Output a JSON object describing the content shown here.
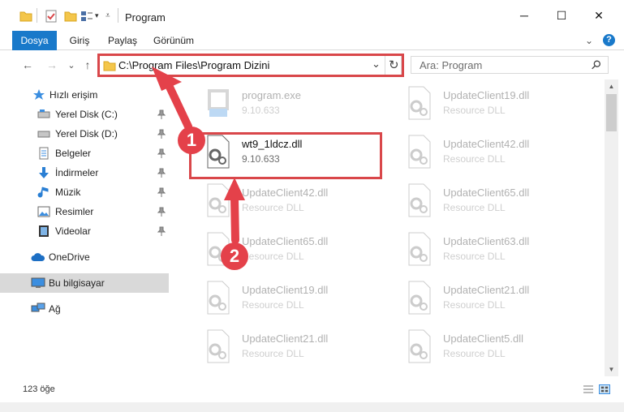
{
  "window": {
    "title": "Program",
    "minimize": "─",
    "maximize": "☐",
    "close": "✕"
  },
  "ribbon": {
    "tabs": [
      "Dosya",
      "Giriş",
      "Paylaş",
      "Görünüm"
    ],
    "expand": "⌄",
    "help": "?"
  },
  "nav": {
    "back": "←",
    "forward": "→",
    "recent": "⌄",
    "up": "↑",
    "address": "C:\\Program Files\\Program Dizini",
    "address_dropdown": "⌄",
    "refresh": "↻",
    "search_placeholder": "Ara: Program",
    "search_icon": "⚲"
  },
  "sidebar": {
    "items": [
      {
        "label": "Hızlı erişim",
        "icon": "star-icon",
        "pinned": false
      },
      {
        "label": "Yerel Disk (C:)",
        "icon": "drive-icon",
        "pinned": true
      },
      {
        "label": "Yerel Disk (D:)",
        "icon": "drive-icon",
        "pinned": true
      },
      {
        "label": "Belgeler",
        "icon": "document-icon",
        "pinned": true
      },
      {
        "label": "İndirmeler",
        "icon": "download-icon",
        "pinned": true
      },
      {
        "label": "Müzik",
        "icon": "music-icon",
        "pinned": true
      },
      {
        "label": "Resimler",
        "icon": "picture-icon",
        "pinned": true
      },
      {
        "label": "Videolar",
        "icon": "video-icon",
        "pinned": true
      },
      {
        "label": "OneDrive",
        "icon": "cloud-icon",
        "pinned": false
      },
      {
        "label": "Bu bilgisayar",
        "icon": "computer-icon",
        "pinned": false
      },
      {
        "label": "Ağ",
        "icon": "network-icon",
        "pinned": false
      }
    ]
  },
  "files": [
    {
      "name": "program.exe",
      "sub": "9.10.633",
      "faded": true,
      "icon": "exe-icon"
    },
    {
      "name": "UpdateClient19.dll",
      "sub": "Resource DLL",
      "faded": true,
      "icon": "dll-icon"
    },
    {
      "name": "wt9_1ldcz.dll",
      "sub": "9.10.633",
      "faded": false,
      "icon": "dll-icon"
    },
    {
      "name": "UpdateClient42.dll",
      "sub": "Resource DLL",
      "faded": true,
      "icon": "dll-icon"
    },
    {
      "name": "UpdateClient42.dll",
      "sub": "Resource DLL",
      "faded": true,
      "icon": "dll-icon"
    },
    {
      "name": "UpdateClient65.dll",
      "sub": "Resource DLL",
      "faded": true,
      "icon": "dll-icon"
    },
    {
      "name": "UpdateClient65.dll",
      "sub": "Resource DLL",
      "faded": true,
      "icon": "dll-icon"
    },
    {
      "name": "UpdateClient63.dll",
      "sub": "Resource DLL",
      "faded": true,
      "icon": "dll-icon"
    },
    {
      "name": "UpdateClient19.dll",
      "sub": "Resource DLL",
      "faded": true,
      "icon": "dll-icon"
    },
    {
      "name": "UpdateClient21.dll",
      "sub": "Resource DLL",
      "faded": true,
      "icon": "dll-icon"
    },
    {
      "name": "UpdateClient21.dll",
      "sub": "Resource DLL",
      "faded": true,
      "icon": "dll-icon"
    },
    {
      "name": "UpdateClient5.dll",
      "sub": "Resource DLL",
      "faded": true,
      "icon": "dll-icon"
    }
  ],
  "status": {
    "count": "123 öğe"
  },
  "annotations": {
    "step1": "1",
    "step2": "2",
    "color": "#e4414a"
  }
}
